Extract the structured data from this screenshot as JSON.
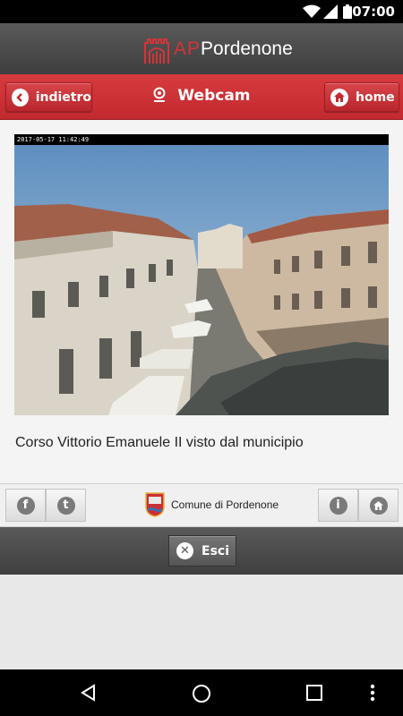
{
  "status_bar": {
    "time": "07:00"
  },
  "app_header": {
    "logo_mark": "AP",
    "logo_text": "Pordenone"
  },
  "nav_bar": {
    "back_label": "indietro",
    "title": "Webcam",
    "home_label": "home"
  },
  "webcam": {
    "timestamp": "2017-05-17 11:42:49",
    "caption": "Corso Vittorio Emanuele II visto dal municipio"
  },
  "footer": {
    "facebook_icon": "f",
    "twitter_icon": "t",
    "comune_label": "Comune di Pordenone",
    "info_icon": "i",
    "exit_label": "Esci"
  },
  "colors": {
    "accent": "#cc3035",
    "header_dark": "#4a4a4a"
  }
}
